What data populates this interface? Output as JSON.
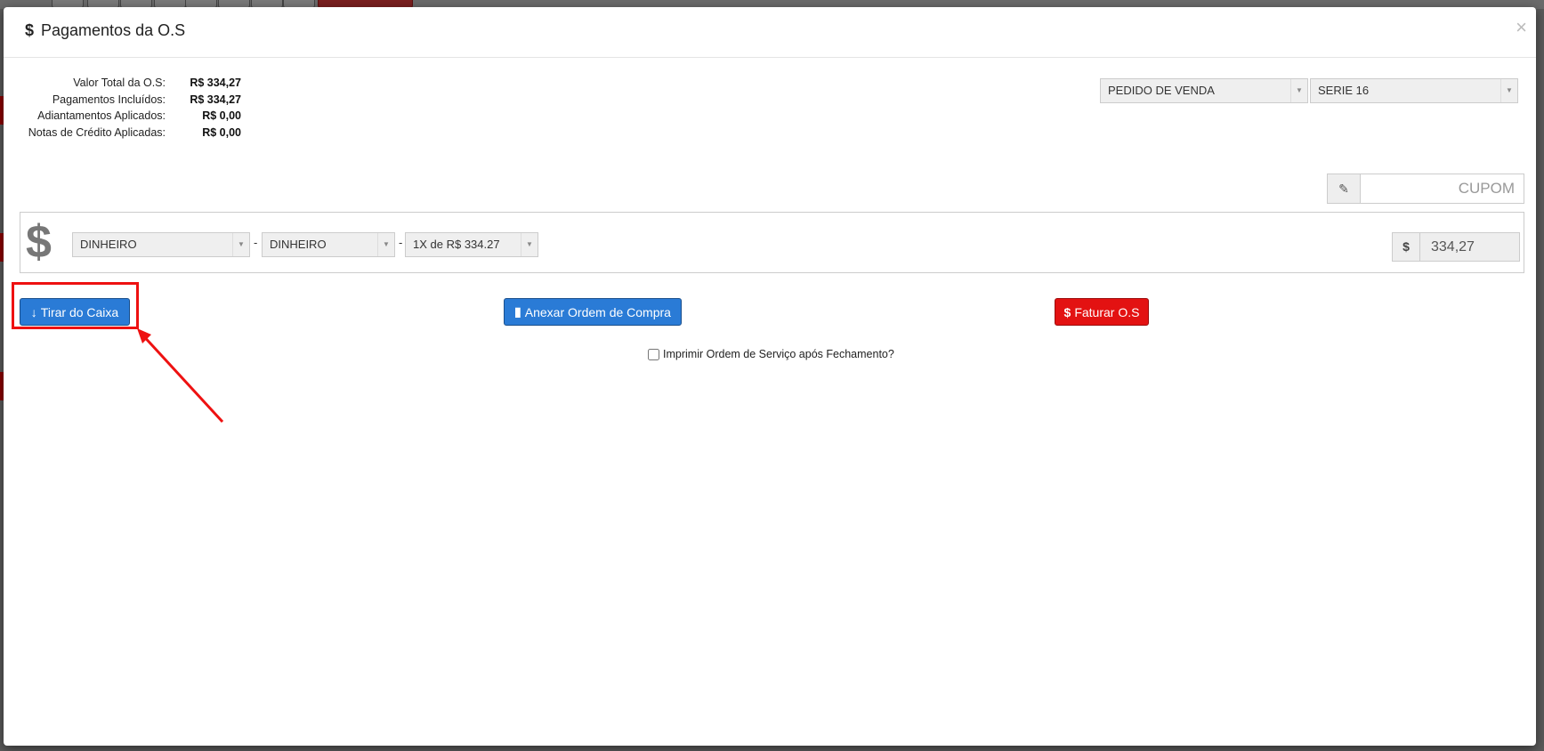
{
  "modal": {
    "title": "Pagamentos da O.S",
    "close_label": "×"
  },
  "summary": [
    {
      "label": "Valor Total da O.S:",
      "value": "R$ 334,27"
    },
    {
      "label": "Pagamentos Incluídos:",
      "value": "R$ 334,27"
    },
    {
      "label": "Adiantamentos Aplicados:",
      "value": "R$ 0,00"
    },
    {
      "label": "Notas de Crédito Aplicadas:",
      "value": "R$ 0,00"
    }
  ],
  "document_type_select": {
    "selected": "PEDIDO DE VENDA"
  },
  "series_select": {
    "selected": "SERIE 16"
  },
  "coupon": {
    "placeholder": "CUPOM"
  },
  "payment": {
    "currency_symbol": "$",
    "method_select": {
      "selected": "DINHEIRO"
    },
    "submethod_select": {
      "selected": "DINHEIRO"
    },
    "installments_select": {
      "selected": "1X de R$ 334.27"
    },
    "separator": "-",
    "amount_prefix": "$",
    "amount_value": "334,27"
  },
  "actions": {
    "withdraw_label": "Tirar do Caixa",
    "attach_label": "Anexar Ordem de Compra",
    "invoice_label": "Faturar O.S"
  },
  "print_option": {
    "label": "Imprimir Ordem de Serviço após Fechamento?",
    "checked": false
  },
  "colors": {
    "primary_button": "#2a7bd6",
    "danger_button": "#e31212",
    "annotation": "#ee1111"
  }
}
